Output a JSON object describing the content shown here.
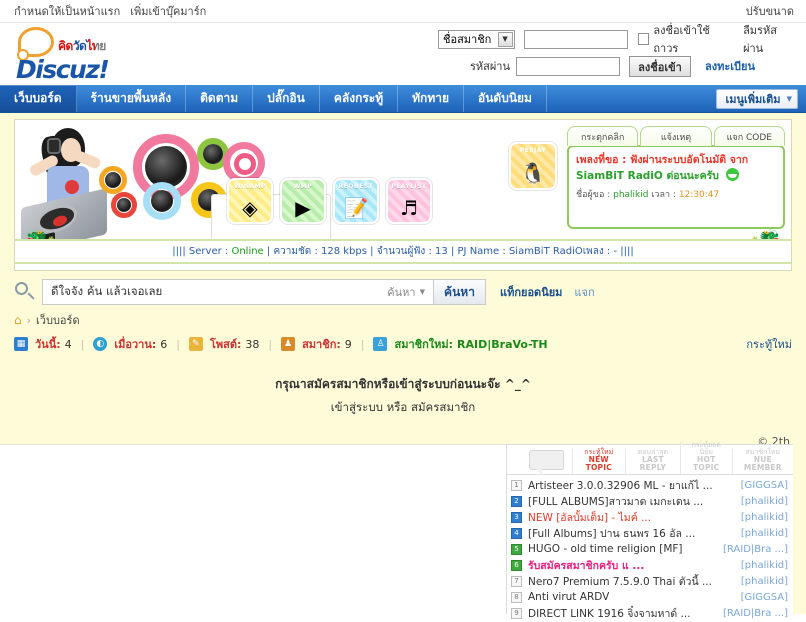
{
  "topbar": {
    "set_homepage": "กำหนดให้เป็นหน้าแรก",
    "add_bookmark": "เพิ่มเข้าบุ๊คมาร์ก",
    "resize": "ปรับขนาด"
  },
  "logo": {
    "thai_text": "คิดวัดไทย",
    "brand": "Discuz",
    "brand_mark": "!"
  },
  "login": {
    "account_type": "ชื่อสมาชิก",
    "username_value": "",
    "username_placeholder": "",
    "password_label": "รหัสผ่าน",
    "password_value": "",
    "remember_label": "ลงชื่อเข้าใช้ถาวร",
    "forgot_password": "ลืมรหัสผ่าน",
    "login_button": "ลงชื่อเข้า",
    "register_link": "ลงทะเบียน"
  },
  "nav": {
    "items": [
      {
        "label": "เว็บบอร์ด",
        "active": true
      },
      {
        "label": "ร้านขายพื้นหลัง",
        "active": false
      },
      {
        "label": "ติดตาม",
        "active": false
      },
      {
        "label": "ปลั๊กอิน",
        "active": false
      },
      {
        "label": "คลังกระทู้",
        "active": false
      },
      {
        "label": "ทักทาย",
        "active": false
      },
      {
        "label": "อันดับนิยม",
        "active": false
      }
    ],
    "more_label": "เมนูเพิ่มเติม"
  },
  "banner": {
    "media_buttons": [
      {
        "caption": "WINAMP",
        "glyph": "◈",
        "theme": "m-yellow"
      },
      {
        "caption": "WMP",
        "glyph": "▶",
        "theme": "m-green"
      },
      {
        "caption": "REQUEST",
        "glyph": "📝",
        "theme": "m-cyan"
      },
      {
        "caption": "PLAYLIST",
        "glyph": "♬",
        "theme": "m-pink"
      }
    ],
    "peejay": {
      "caption": "PEEJAY",
      "glyph": "🐧"
    },
    "server_status": {
      "prefix": "||||",
      "server_label": "Server :",
      "server_value": "Online",
      "bitrate_label": "ความชัด :",
      "bitrate_value": "128 kbps",
      "listeners_label": "จำนวนผู้ฟัง :",
      "listeners_value": "13",
      "pj_label": "PJ Name :",
      "pj_value": "SiamBiT RadiOเพลง : -",
      "suffix": "||||"
    }
  },
  "radio_panel": {
    "tabs": [
      {
        "label": "กระตุกคลิก"
      },
      {
        "label": "แจ้งเหตุ"
      },
      {
        "label": "แจก CODE"
      }
    ],
    "song_label": "เพลงที่ขอ :",
    "song_value": "ฟังผ่านระบบอัตโนมัติ จาก",
    "station": "SiamBiT RadiO ต่อนนะครับ",
    "requester_label": "ชื่อผู้ขอ :",
    "requester_value": "phalikid",
    "time_label": "เวลา :",
    "time_value": "12:30:47"
  },
  "search": {
    "value": "ดีใจจัง ค้น แล้วเจอเลย",
    "placeholder": "ดีใจจัง ค้น แล้วเจอเลย",
    "scope_label": "ค้นหา",
    "button_label": "ค้นหา",
    "hot_tags": "แท็กยอดนิยม",
    "give_link": "แจก"
  },
  "breadcrumb": {
    "home_icon": "home-icon",
    "separator": "›",
    "current": "เว็บบอร์ด"
  },
  "stats": {
    "items": [
      {
        "icon": "chart-icon",
        "key": "วันนี้:",
        "value": "4",
        "color": "#c33"
      },
      {
        "icon": "clock-icon",
        "key": "เมื่อวาน:",
        "value": "6",
        "color": "#c33"
      },
      {
        "icon": "pencil-icon",
        "key": "โพสต์:",
        "value": "38",
        "color": "#c33"
      },
      {
        "icon": "users-icon",
        "key": "สมาชิก:",
        "value": "9",
        "color": "#c33"
      }
    ],
    "new_member_label": "สมาชิกใหม่:",
    "new_member_value": "RAID|BraVo-TH",
    "new_thread_link": "กระทู้ใหม่"
  },
  "notice": {
    "line1": "กรุณาสมัครสมาชิกหรือเข้าสู่ระบบก่อนนะจ๊ะ ^_^",
    "login_link": "เข้าสู่ระบบ",
    "or_text": "หรือ",
    "register_link": "สมัครสมาชิก"
  },
  "copyright": "© 2th",
  "topic_panel": {
    "tabs": [
      {
        "th": "กระทู้ใหม่",
        "en": "NEW TOPIC",
        "active": true
      },
      {
        "th": "ตอบล่าสุด",
        "en": "LAST REPLY",
        "active": false
      },
      {
        "th": "กระทู้ยอดนิยม",
        "en": "HOT TOPIC",
        "active": false
      },
      {
        "th": "สมาชิกใหม่",
        "en": "NUE MEMBER",
        "active": false
      }
    ],
    "rows": [
      {
        "num": "1",
        "num_style": "",
        "title": "Artisteer 3.0.0.32906 ML - ยาแก้ไ ...",
        "title_style": "",
        "author": "[GIGGSA]",
        "author_style": ""
      },
      {
        "num": "2",
        "num_style": "b",
        "title": "[FULL ALBUMS]สาวมาด เมกะเดน ...",
        "title_style": "",
        "author": "[phalikid]",
        "author_style": ""
      },
      {
        "num": "3",
        "num_style": "b",
        "title": "NEW [อัลบั้มเต็ม] - ไมค์ ...",
        "title_style": "red",
        "author": "[phalikid]",
        "author_style": ""
      },
      {
        "num": "4",
        "num_style": "b",
        "title": "[Full Albums] ปาน ธนพร 16 อัล ...",
        "title_style": "",
        "author": "[phalikid]",
        "author_style": ""
      },
      {
        "num": "5",
        "num_style": "g",
        "title": "HUGO - old time religion [MF]",
        "title_style": "",
        "author": "[RAID|Bra ...]",
        "author_style": ""
      },
      {
        "num": "6",
        "num_style": "g",
        "title": "รับสมัครสมาชิกครับ แ ...",
        "title_style": "pink",
        "author": "[phalikid]",
        "author_style": ""
      },
      {
        "num": "7",
        "num_style": "",
        "title": "Nero7 Premium 7.5.9.0 Thai ตัวนี้ ...",
        "title_style": "",
        "author": "[phalikid]",
        "author_style": ""
      },
      {
        "num": "8",
        "num_style": "",
        "title": "Anti virut ARDV",
        "title_style": "",
        "author": "[GIGGSA]",
        "author_style": ""
      },
      {
        "num": "9",
        "num_style": "",
        "title": "DIRECT LINK 1916 จิ๋งจามหาด์ ...",
        "title_style": "",
        "author": "[RAID|Bra ...]",
        "author_style": ""
      }
    ]
  },
  "colors": {
    "nav_blue": "#1d62b8",
    "cream": "#fdfbd8",
    "link_blue": "#1a4f8e",
    "accent_red": "#e03b2a",
    "accent_green": "#2aa02a"
  }
}
